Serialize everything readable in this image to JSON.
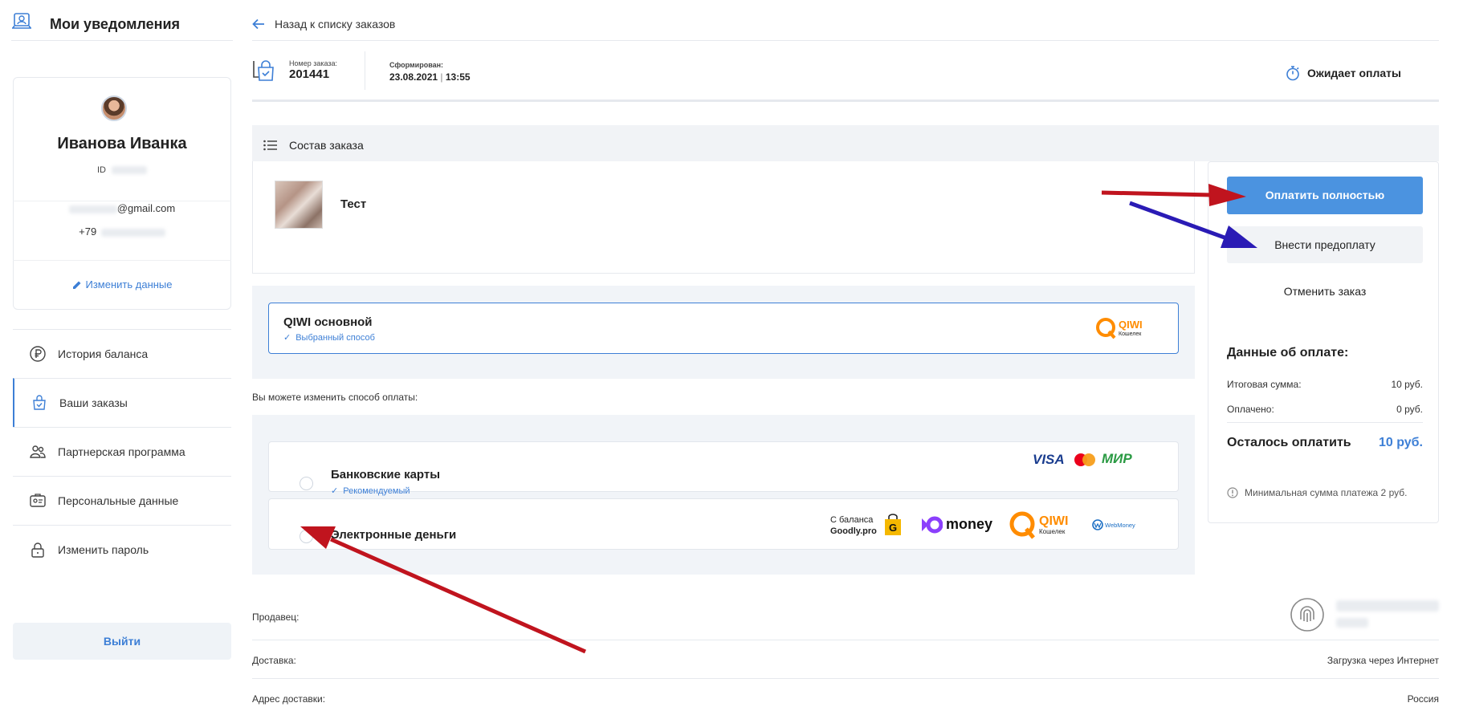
{
  "sidebar": {
    "title": "Мои уведомления",
    "profile": {
      "name": "Иванова Иванка",
      "id_label": "ID",
      "email_suffix": "@gmail.com",
      "phone_prefix": "+79",
      "edit_label": "Изменить данные"
    },
    "menu": [
      {
        "label": "История баланса",
        "icon": "ruble-icon"
      },
      {
        "label": "Ваши заказы",
        "icon": "orders-icon"
      },
      {
        "label": "Партнерская программа",
        "icon": "partners-icon"
      },
      {
        "label": "Персональные данные",
        "icon": "id-card-icon"
      },
      {
        "label": "Изменить пароль",
        "icon": "lock-icon"
      }
    ],
    "logout_label": "Выйти"
  },
  "header": {
    "back_label": "Назад к списку заказов",
    "order_number_label": "Номер заказа:",
    "order_number": "201441",
    "created_label": "Сформирован:",
    "created_date": "23.08.2021",
    "created_time": "13:55",
    "status": "Ожидает оплаты"
  },
  "composition": {
    "title": "Состав заказа",
    "item_name": "Тест"
  },
  "selected_method": {
    "name": "QIWI основной",
    "sub": "Выбранный способ",
    "logo_text": "QIWI",
    "logo_sub": "Кошелек"
  },
  "change_note": "Вы можете изменить способ оплаты:",
  "methods": [
    {
      "name": "Банковские карты",
      "sub": "Рекомендуемый"
    },
    {
      "name": "Электронные деньги"
    }
  ],
  "logos": {
    "visa": "VISA",
    "mir": "МИР",
    "goodly_line1": "С баланса",
    "goodly_line2": "Goodly.pro",
    "goodly_icon": "G",
    "money": "money",
    "webmoney": "WebMoney"
  },
  "actions": {
    "pay_full": "Оплатить полностью",
    "prepay": "Внести предоплату",
    "cancel": "Отменить заказ"
  },
  "payment": {
    "title": "Данные об оплате:",
    "total_label": "Итоговая сумма:",
    "total_value": "10 руб.",
    "paid_label": "Оплачено:",
    "paid_value": "0 руб.",
    "left_label": "Осталось оплатить",
    "left_value": "10 руб.",
    "min_note": "Минимальная сумма платежа 2 руб."
  },
  "info": {
    "seller_label": "Продавец:",
    "delivery_label": "Доставка:",
    "delivery_value": "Загрузка через Интернет",
    "address_label": "Адрес доставки:",
    "address_value": "Россия"
  },
  "colors": {
    "accent": "#3d7fd6",
    "button_primary": "#4b93e0",
    "arrow_red": "#c0141e",
    "arrow_blue": "#2a1bb5"
  }
}
